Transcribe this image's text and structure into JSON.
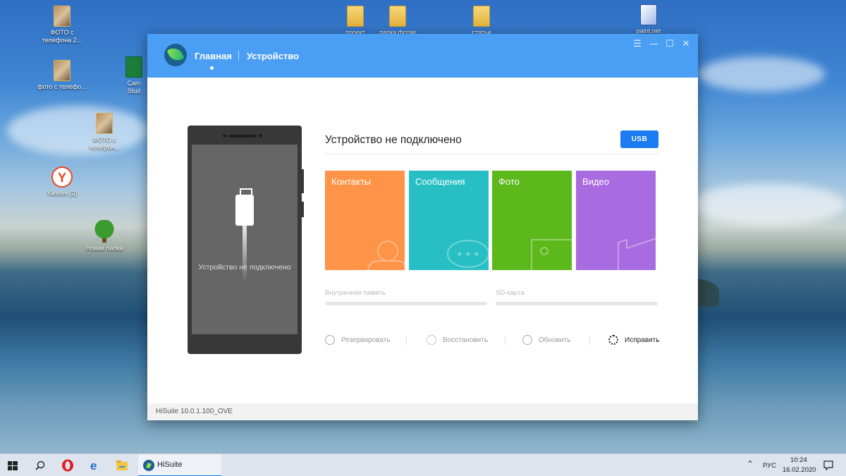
{
  "desktop": {
    "icons": [
      {
        "label": "ФОТО с телефона 2...",
        "name": "desktop-icon-foto-telefona-2"
      },
      {
        "label": "фото с телефо...",
        "name": "desktop-icon-foto-telefona"
      },
      {
        "label": "ФОТО с телефон...",
        "name": "desktop-icon-foto-telefon"
      },
      {
        "label": "Yandex (2)",
        "name": "desktop-icon-yandex"
      },
      {
        "label": "Новая папка",
        "name": "desktop-icon-new-folder"
      },
      {
        "label": "Cam Stud",
        "name": "desktop-icon-camtasia"
      },
      {
        "label": "проект",
        "name": "desktop-icon-proekt"
      },
      {
        "label": "папка фотки",
        "name": "desktop-icon-papka-fotki"
      },
      {
        "label": "статьи",
        "name": "desktop-icon-stati"
      },
      {
        "label": "paint.net",
        "name": "desktop-icon-paint-net"
      }
    ]
  },
  "app": {
    "tabs": [
      {
        "label": "Главная",
        "active": true
      },
      {
        "label": "Устройство",
        "active": false
      }
    ],
    "window_controls": {
      "menu": "☰",
      "minimize": "—",
      "maximize": "☐",
      "close": "✕"
    },
    "phone_status": "Устройство не подключено",
    "status_title": "Устройство не подключено",
    "usb_button": "USB",
    "tiles": [
      {
        "label": "Контакты",
        "color": "#ff9448",
        "icon": "contact-icon"
      },
      {
        "label": "Сообщения",
        "color": "#27bfc4",
        "icon": "message-icon"
      },
      {
        "label": "Фото",
        "color": "#5cb81b",
        "icon": "photo-icon"
      },
      {
        "label": "Видео",
        "color": "#a96ce0",
        "icon": "video-icon"
      }
    ],
    "storage": {
      "internal": "Внутренняя память",
      "sd": "SD-карта"
    },
    "actions": [
      {
        "label": "Резервировать",
        "icon": "backup-icon"
      },
      {
        "label": "Восстановить",
        "icon": "restore-icon"
      },
      {
        "label": "Обновить",
        "icon": "update-icon"
      },
      {
        "label": "Исправить",
        "icon": "repair-icon"
      }
    ],
    "version": "HiSuite 10.0.1.100_OVE",
    "accent": "#4a9ff5"
  },
  "taskbar": {
    "app_label": "HiSuite",
    "lang": "РУС",
    "time": "10:24",
    "date": "16.02.2020"
  }
}
